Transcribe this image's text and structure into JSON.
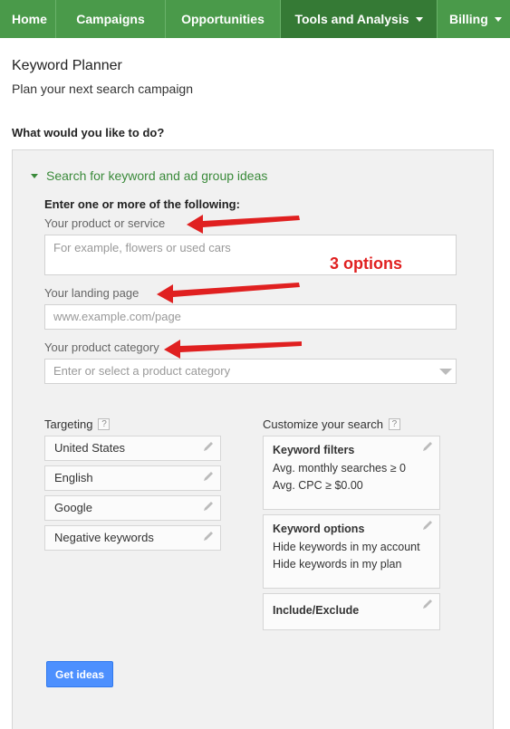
{
  "nav": {
    "items": [
      {
        "label": "Home",
        "active": false,
        "dropdown": false
      },
      {
        "label": "Campaigns",
        "active": false,
        "dropdown": false
      },
      {
        "label": "Opportunities",
        "active": false,
        "dropdown": false
      },
      {
        "label": "Tools and Analysis",
        "active": true,
        "dropdown": true
      },
      {
        "label": "Billing",
        "active": false,
        "dropdown": true
      }
    ]
  },
  "header": {
    "title": "Keyword Planner",
    "subtitle": "Plan your next search campaign",
    "question": "What would you like to do?"
  },
  "search": {
    "section_label": "Search for keyword and ad group ideas",
    "instruction": "Enter one or more of the following:",
    "product_label": "Your product or service",
    "product_placeholder": "For example, flowers or used cars",
    "landing_label": "Your landing page",
    "landing_placeholder": "www.example.com/page",
    "category_label": "Your product category",
    "category_placeholder": "Enter or select a product category",
    "annotation": "3 options"
  },
  "targeting": {
    "title": "Targeting",
    "help": "?",
    "items": [
      "United States",
      "English",
      "Google",
      "Negative keywords"
    ]
  },
  "customize": {
    "title": "Customize your search",
    "help": "?",
    "filters": {
      "heading": "Keyword filters",
      "lines": [
        "Avg. monthly searches ≥ 0",
        "Avg. CPC ≥ $0.00"
      ]
    },
    "options": {
      "heading": "Keyword options",
      "lines": [
        "Hide keywords in my account",
        "Hide keywords in my plan"
      ]
    },
    "include_exclude": {
      "heading": "Include/Exclude"
    }
  },
  "actions": {
    "get_ideas": "Get ideas"
  },
  "colors": {
    "nav_bg": "#4a9a4a",
    "nav_active": "#357a35",
    "accent_green": "#3a8a3a",
    "button_blue": "#4d90fe",
    "annotation_red": "#e02020"
  },
  "icons": [
    "caret-down-icon",
    "expand-triangle-icon",
    "help-icon",
    "pencil-icon",
    "dropdown-arrow-icon",
    "red-arrow-annotation"
  ]
}
